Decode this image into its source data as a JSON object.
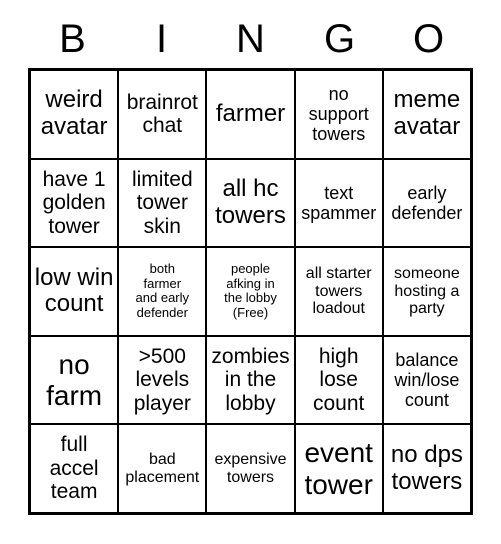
{
  "card": {
    "header_letters": [
      "B",
      "I",
      "N",
      "G",
      "O"
    ],
    "grid_size": 5,
    "colors": {
      "background": "#ffffff",
      "text": "#000000",
      "border": "#000000"
    },
    "cells": [
      {
        "text": "weird\navatar",
        "size": "lg"
      },
      {
        "text": "brainrot\nchat",
        "size": "md"
      },
      {
        "text": "farmer",
        "size": "lg"
      },
      {
        "text": "no\nsupport\ntowers",
        "size": "sm"
      },
      {
        "text": "meme\navatar",
        "size": "lg"
      },
      {
        "text": "have 1\ngolden\ntower",
        "size": "md"
      },
      {
        "text": "limited\ntower\nskin",
        "size": "md"
      },
      {
        "text": "all hc\ntowers",
        "size": "lg"
      },
      {
        "text": "text\nspammer",
        "size": "sm"
      },
      {
        "text": "early\ndefender",
        "size": "sm"
      },
      {
        "text": "low win\ncount",
        "size": "lg"
      },
      {
        "text": "both\nfarmer\nand early\ndefender",
        "size": "xxs"
      },
      {
        "text": "people\nafking in\nthe lobby\n(Free)",
        "size": "xxs"
      },
      {
        "text": "all starter\ntowers\nloadout",
        "size": "xs"
      },
      {
        "text": "someone\nhosting a\nparty",
        "size": "xs"
      },
      {
        "text": "no\nfarm",
        "size": "xl"
      },
      {
        "text": ">500\nlevels\nplayer",
        "size": "md"
      },
      {
        "text": "zombies\nin the\nlobby",
        "size": "md"
      },
      {
        "text": "high\nlose\ncount",
        "size": "md"
      },
      {
        "text": "balance\nwin/lose\ncount",
        "size": "sm"
      },
      {
        "text": "full\naccel\nteam",
        "size": "md"
      },
      {
        "text": "bad\nplacement",
        "size": "xs"
      },
      {
        "text": "expensive\ntowers",
        "size": "xs"
      },
      {
        "text": "event\ntower",
        "size": "xl"
      },
      {
        "text": "no dps\ntowers",
        "size": "lg"
      }
    ]
  }
}
